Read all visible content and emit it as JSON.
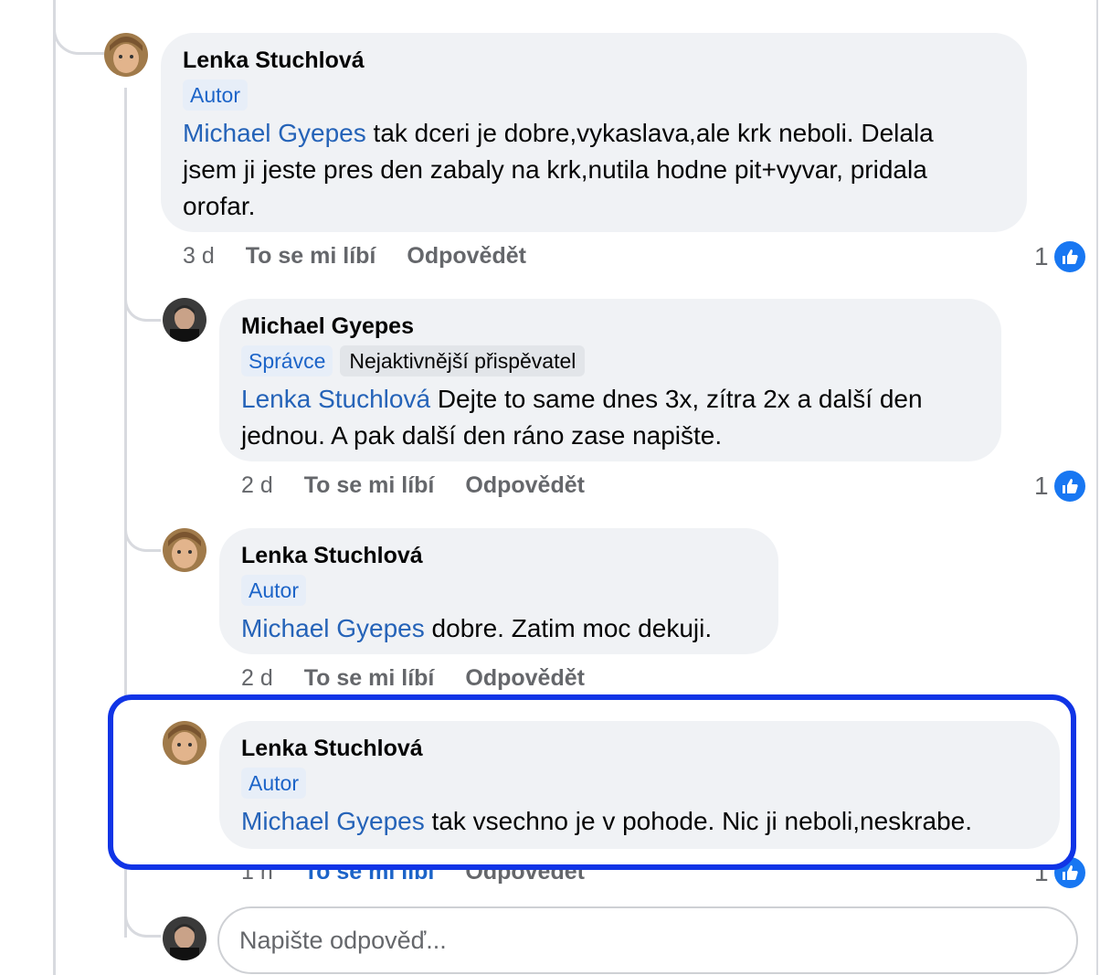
{
  "comments": [
    {
      "author": "Lenka Stuchlová",
      "badge": "Autor",
      "mention": "Michael Gyepes",
      "text_lines": [
        " tak dceri je dobre,vykaslava,ale krk neboli.  Delala",
        "jsem ji jeste pres den zabaly na krk,nutila hodne pit+vyvar, pridala",
        "orofar."
      ],
      "time": "3 d",
      "like_label": "To se mi líbí",
      "reply_label": "Odpovědět",
      "reaction_count": "1"
    },
    {
      "author": "Michael Gyepes",
      "badge": "Správce",
      "badge2": "Nejaktivnější přispěvatel",
      "mention": "Lenka Stuchlová",
      "text_lines": [
        " Dejte to same dnes 3x, zítra 2x a další den",
        "jednou. A pak další den ráno zase napište."
      ],
      "time": "2 d",
      "like_label": "To se mi líbí",
      "reply_label": "Odpovědět",
      "reaction_count": "1"
    },
    {
      "author": "Lenka Stuchlová",
      "badge": "Autor",
      "mention": "Michael Gyepes",
      "text_lines": [
        " dobre. Zatim moc dekuji."
      ],
      "time": "2 d",
      "like_label": "To se mi líbí",
      "reply_label": "Odpovědět"
    },
    {
      "author": "Lenka Stuchlová",
      "badge": "Autor",
      "mention": "Michael Gyepes",
      "text_lines": [
        " tak vsechno je v pohode. Nic ji neboli,neskrabe."
      ],
      "time": "1 h",
      "like_label": "To se mi líbí",
      "reply_label": "Odpovědět",
      "reaction_count": "1"
    }
  ],
  "reply_input": {
    "placeholder": "Napište odpověď..."
  },
  "colors": {
    "highlight": "#1034e6",
    "like": "#1877f2",
    "mention": "#2563b8",
    "bubble": "#f0f2f5"
  }
}
